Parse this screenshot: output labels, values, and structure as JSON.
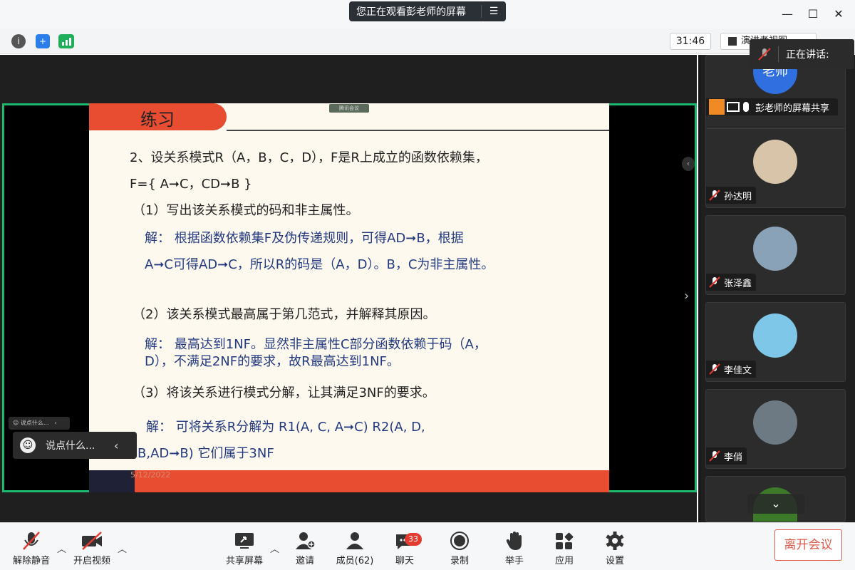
{
  "titlebar": {
    "banner_text": "您正在观看彭老师的屏幕",
    "minimize": "—",
    "maximize": "☐",
    "close": "✕"
  },
  "statusbar": {
    "timer": "31:46",
    "view_label": "演讲者视图"
  },
  "slide": {
    "title": "练习",
    "watermark": "腾讯会议",
    "lines": [
      "2、设关系模式R（A，B，C，D），F是R上成立的函数依赖集，",
      "F={ A➞C，CD➞B }",
      "（1）写出该关系模式的码和非主属性。",
      "解：   根据函数依赖集F及伪传递规则，可得AD➞B，根据",
      "A➞C可得AD➞C，所以R的码是（A，D）。B，C为非主属性。",
      "（2）该关系模式最高属于第几范式，并解释其原因。",
      "解：   最高达到1NF。显然非主属性C部分函数依赖于码（A，",
      "D），不满足2NF的要求，故R最高达到1NF。",
      "（3）将该关系进行模式分解，让其满足3NF的要求。",
      "解：   可将关系R分解为 R1(A, C, A➞C)   R2(A, D,",
      "B,AD➞B) 它们属于3NF"
    ],
    "date": "5/12/2022"
  },
  "chat": {
    "mini_text": "说点什么...",
    "placeholder": "说点什么..."
  },
  "speaking": {
    "label": "正在讲话:"
  },
  "participants": [
    {
      "name": "彭老师的屏幕共享",
      "avatar_text": "老师",
      "avatar_color": "#2f6fe0"
    },
    {
      "name": "孙达明",
      "avatar_color": "#d8c4a8"
    },
    {
      "name": "张泽鑫",
      "avatar_color": "#8aa2b8"
    },
    {
      "name": "李佳文",
      "avatar_color": "#7fc7e8"
    },
    {
      "name": "李俏",
      "avatar_color": "#6d7a84"
    },
    {
      "name": "",
      "avatar_color": "#3c7a2a"
    }
  ],
  "toolbar": {
    "unmute": "解除静音",
    "start_video": "开启视频",
    "share_screen": "共享屏幕",
    "invite": "邀请",
    "members": "成员(62)",
    "chat": "聊天",
    "chat_badge": "33",
    "record": "录制",
    "raise_hand": "举手",
    "apps": "应用",
    "settings": "设置",
    "leave": "离开会议"
  }
}
